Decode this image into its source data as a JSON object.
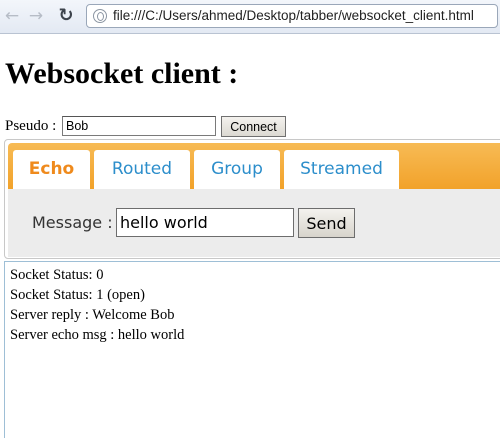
{
  "browser": {
    "back_icon": "←",
    "forward_icon": "→",
    "reload_icon": "↻",
    "url": "file:///C:/Users/ahmed/Desktop/tabber/websocket_client.html"
  },
  "page": {
    "title": "Websocket client :",
    "pseudo_label": "Pseudo :",
    "pseudo_value": "Bob",
    "connect_label": "Connect"
  },
  "tabs": [
    {
      "label": "Echo",
      "active": true
    },
    {
      "label": "Routed",
      "active": false
    },
    {
      "label": "Group",
      "active": false
    },
    {
      "label": "Streamed",
      "active": false
    }
  ],
  "echo": {
    "message_label": "Message :",
    "message_value": "hello world",
    "send_label": "Send"
  },
  "log": [
    "Socket Status: 0",
    "Socket Status: 1 (open)",
    "Server reply : Welcome Bob",
    "Server echo msg : hello world"
  ],
  "colors": {
    "tab_strip": "#f2a22a",
    "active_tab_text": "#ef8a1c",
    "inactive_tab_text": "#2c8ecb"
  }
}
